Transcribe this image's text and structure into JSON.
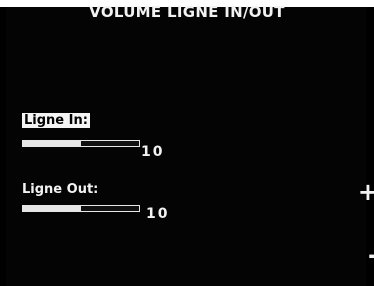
{
  "screen": {
    "title": "VOLUME LIGNE IN/OUT"
  },
  "line_in": {
    "label": "Ligne In:",
    "value": "10",
    "level_fraction": 0.5
  },
  "line_out": {
    "label": "Ligne Out:",
    "value": "10",
    "level_fraction": 0.5
  },
  "side_buttons": {
    "plus": "+",
    "minus": "-"
  },
  "colors": {
    "background": "#000000",
    "foreground": "#f2f2f2",
    "highlight": "#f4f4f4"
  }
}
